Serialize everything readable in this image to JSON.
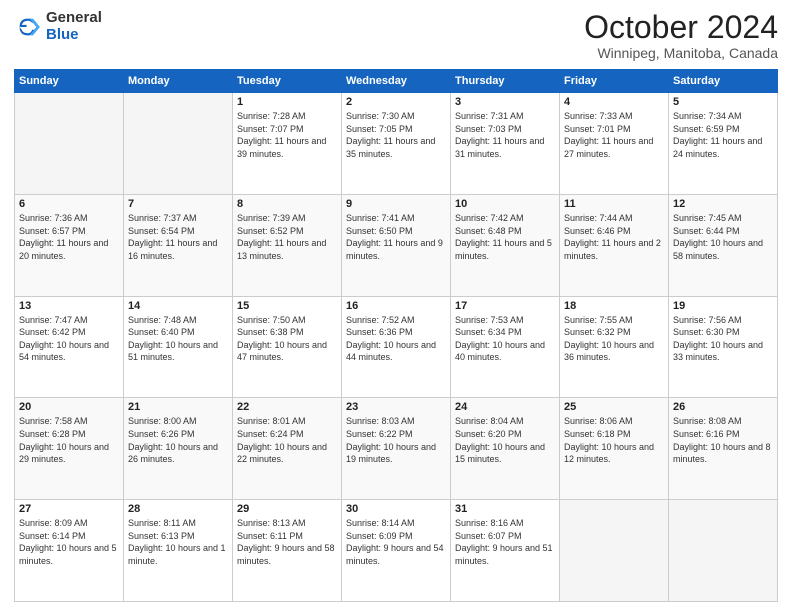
{
  "header": {
    "logo_general": "General",
    "logo_blue": "Blue",
    "title": "October 2024",
    "subtitle": "Winnipeg, Manitoba, Canada"
  },
  "calendar": {
    "days_of_week": [
      "Sunday",
      "Monday",
      "Tuesday",
      "Wednesday",
      "Thursday",
      "Friday",
      "Saturday"
    ],
    "weeks": [
      [
        {
          "day": "",
          "empty": true
        },
        {
          "day": "",
          "empty": true
        },
        {
          "day": "1",
          "sunrise": "7:28 AM",
          "sunset": "7:07 PM",
          "daylight": "11 hours and 39 minutes."
        },
        {
          "day": "2",
          "sunrise": "7:30 AM",
          "sunset": "7:05 PM",
          "daylight": "11 hours and 35 minutes."
        },
        {
          "day": "3",
          "sunrise": "7:31 AM",
          "sunset": "7:03 PM",
          "daylight": "11 hours and 31 minutes."
        },
        {
          "day": "4",
          "sunrise": "7:33 AM",
          "sunset": "7:01 PM",
          "daylight": "11 hours and 27 minutes."
        },
        {
          "day": "5",
          "sunrise": "7:34 AM",
          "sunset": "6:59 PM",
          "daylight": "11 hours and 24 minutes."
        }
      ],
      [
        {
          "day": "6",
          "sunrise": "7:36 AM",
          "sunset": "6:57 PM",
          "daylight": "11 hours and 20 minutes."
        },
        {
          "day": "7",
          "sunrise": "7:37 AM",
          "sunset": "6:54 PM",
          "daylight": "11 hours and 16 minutes."
        },
        {
          "day": "8",
          "sunrise": "7:39 AM",
          "sunset": "6:52 PM",
          "daylight": "11 hours and 13 minutes."
        },
        {
          "day": "9",
          "sunrise": "7:41 AM",
          "sunset": "6:50 PM",
          "daylight": "11 hours and 9 minutes."
        },
        {
          "day": "10",
          "sunrise": "7:42 AM",
          "sunset": "6:48 PM",
          "daylight": "11 hours and 5 minutes."
        },
        {
          "day": "11",
          "sunrise": "7:44 AM",
          "sunset": "6:46 PM",
          "daylight": "11 hours and 2 minutes."
        },
        {
          "day": "12",
          "sunrise": "7:45 AM",
          "sunset": "6:44 PM",
          "daylight": "10 hours and 58 minutes."
        }
      ],
      [
        {
          "day": "13",
          "sunrise": "7:47 AM",
          "sunset": "6:42 PM",
          "daylight": "10 hours and 54 minutes."
        },
        {
          "day": "14",
          "sunrise": "7:48 AM",
          "sunset": "6:40 PM",
          "daylight": "10 hours and 51 minutes."
        },
        {
          "day": "15",
          "sunrise": "7:50 AM",
          "sunset": "6:38 PM",
          "daylight": "10 hours and 47 minutes."
        },
        {
          "day": "16",
          "sunrise": "7:52 AM",
          "sunset": "6:36 PM",
          "daylight": "10 hours and 44 minutes."
        },
        {
          "day": "17",
          "sunrise": "7:53 AM",
          "sunset": "6:34 PM",
          "daylight": "10 hours and 40 minutes."
        },
        {
          "day": "18",
          "sunrise": "7:55 AM",
          "sunset": "6:32 PM",
          "daylight": "10 hours and 36 minutes."
        },
        {
          "day": "19",
          "sunrise": "7:56 AM",
          "sunset": "6:30 PM",
          "daylight": "10 hours and 33 minutes."
        }
      ],
      [
        {
          "day": "20",
          "sunrise": "7:58 AM",
          "sunset": "6:28 PM",
          "daylight": "10 hours and 29 minutes."
        },
        {
          "day": "21",
          "sunrise": "8:00 AM",
          "sunset": "6:26 PM",
          "daylight": "10 hours and 26 minutes."
        },
        {
          "day": "22",
          "sunrise": "8:01 AM",
          "sunset": "6:24 PM",
          "daylight": "10 hours and 22 minutes."
        },
        {
          "day": "23",
          "sunrise": "8:03 AM",
          "sunset": "6:22 PM",
          "daylight": "10 hours and 19 minutes."
        },
        {
          "day": "24",
          "sunrise": "8:04 AM",
          "sunset": "6:20 PM",
          "daylight": "10 hours and 15 minutes."
        },
        {
          "day": "25",
          "sunrise": "8:06 AM",
          "sunset": "6:18 PM",
          "daylight": "10 hours and 12 minutes."
        },
        {
          "day": "26",
          "sunrise": "8:08 AM",
          "sunset": "6:16 PM",
          "daylight": "10 hours and 8 minutes."
        }
      ],
      [
        {
          "day": "27",
          "sunrise": "8:09 AM",
          "sunset": "6:14 PM",
          "daylight": "10 hours and 5 minutes."
        },
        {
          "day": "28",
          "sunrise": "8:11 AM",
          "sunset": "6:13 PM",
          "daylight": "10 hours and 1 minute."
        },
        {
          "day": "29",
          "sunrise": "8:13 AM",
          "sunset": "6:11 PM",
          "daylight": "9 hours and 58 minutes."
        },
        {
          "day": "30",
          "sunrise": "8:14 AM",
          "sunset": "6:09 PM",
          "daylight": "9 hours and 54 minutes."
        },
        {
          "day": "31",
          "sunrise": "8:16 AM",
          "sunset": "6:07 PM",
          "daylight": "9 hours and 51 minutes."
        },
        {
          "day": "",
          "empty": true
        },
        {
          "day": "",
          "empty": true
        }
      ]
    ]
  }
}
